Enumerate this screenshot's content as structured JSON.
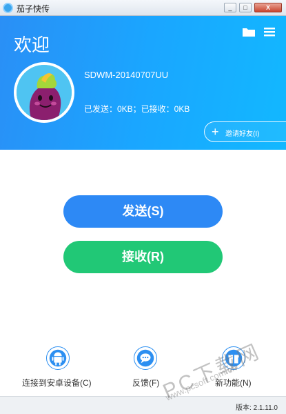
{
  "window": {
    "title": "茄子快传",
    "minimize": "_",
    "maximize": "□",
    "close": "X"
  },
  "header": {
    "welcome": "欢迎",
    "username": "SDWM-20140707UU",
    "stats": "已发送：0KB；已接收：0KB",
    "invite_label": "邀请好友(I)"
  },
  "actions": {
    "send": "发送(S)",
    "receive": "接收(R)"
  },
  "bottom": {
    "android": "连接到安卓设备(C)",
    "feedback": "反馈(F)",
    "newfeature": "新功能(N)"
  },
  "status": {
    "version": "版本: 2.1.11.0"
  },
  "watermark": {
    "big": "PC下载网",
    "small": "www.pcsoft.com.cn"
  },
  "colors": {
    "header_start": "#2a8ff6",
    "header_end": "#12b8ff",
    "send": "#2d89f5",
    "receive": "#21c876",
    "icon_accent": "#2c8ff1"
  }
}
